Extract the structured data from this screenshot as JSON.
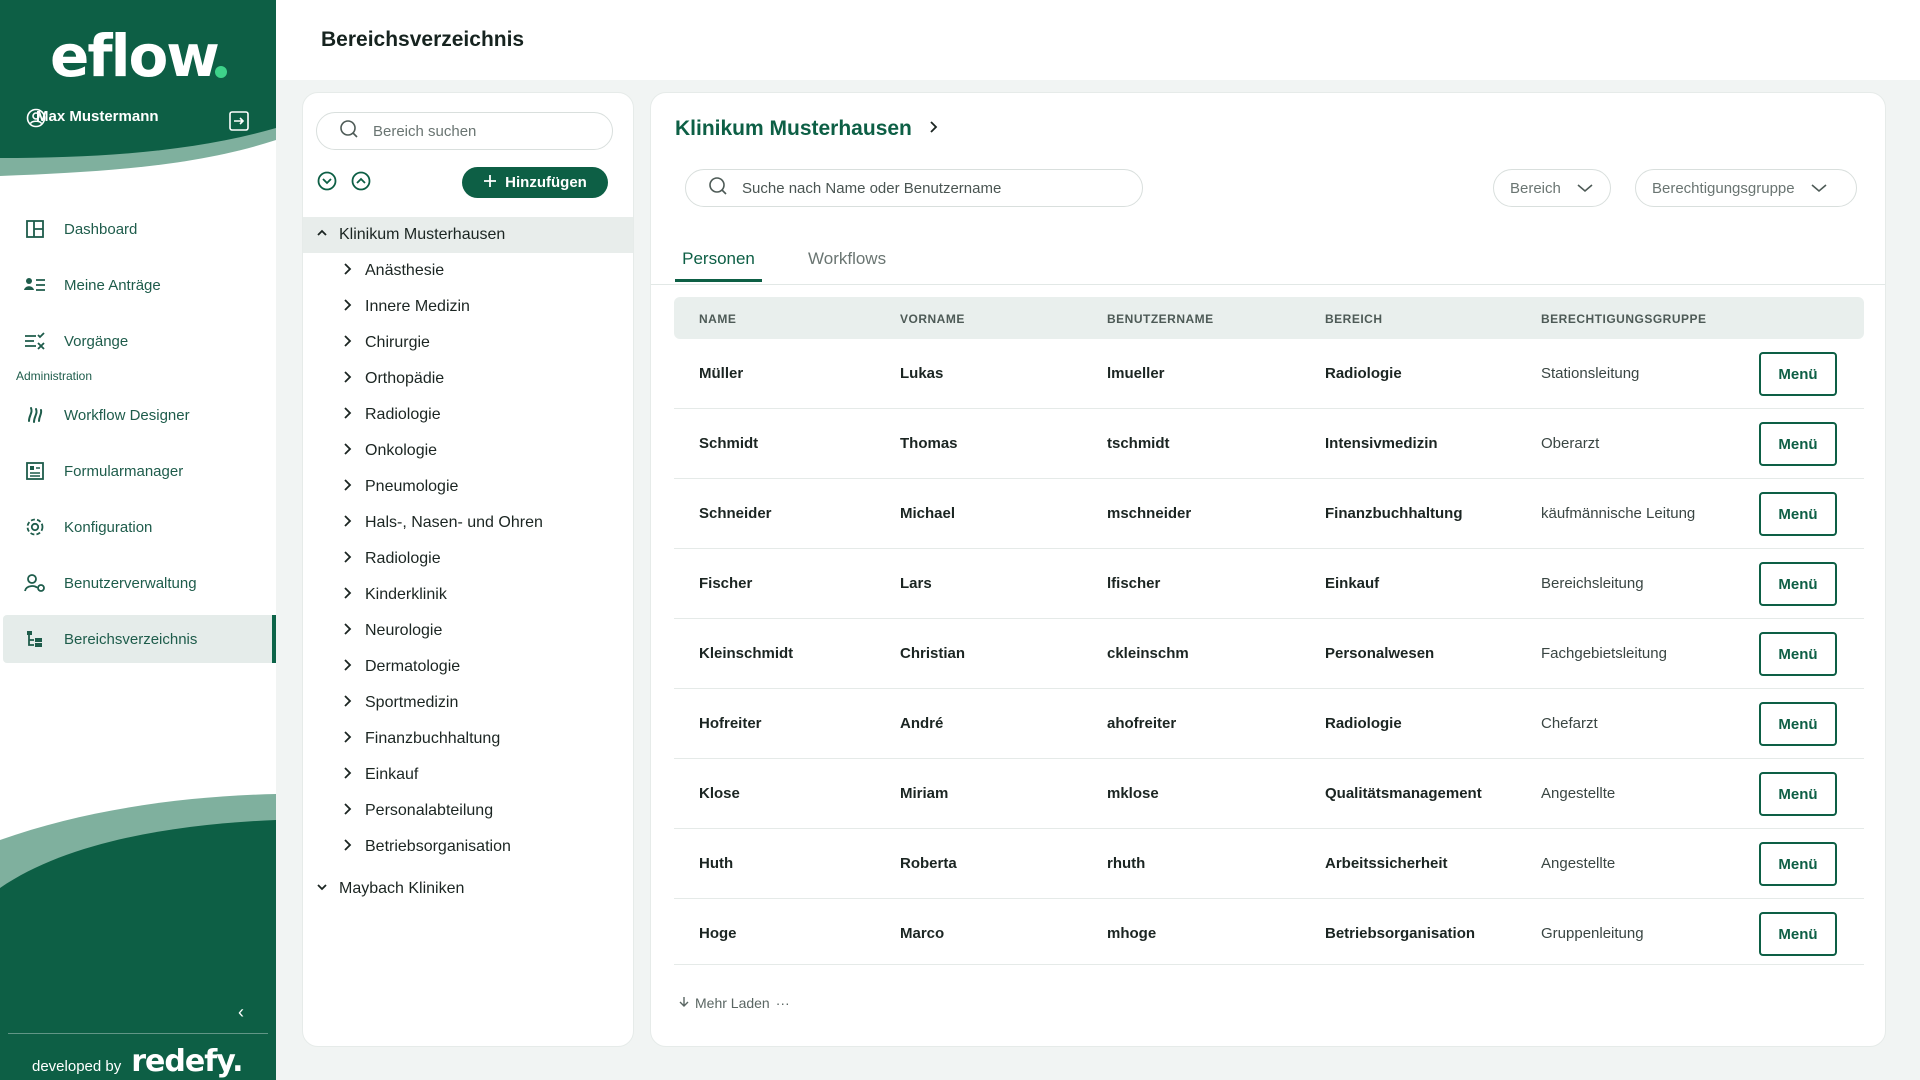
{
  "brand": {
    "logo_text": "eflow",
    "accent": "#0d5f45",
    "accent_light": "#3ed38a"
  },
  "user": {
    "name": "Max Mustermann"
  },
  "nav": {
    "items": [
      {
        "label": "Dashboard",
        "icon": "dashboard-icon"
      },
      {
        "label": "Meine Anträge",
        "icon": "list-user-icon"
      },
      {
        "label": "Vorgänge",
        "icon": "checklist-icon"
      }
    ],
    "section_label": "Administration",
    "admin_items": [
      {
        "label": "Workflow Designer",
        "icon": "workflow-icon"
      },
      {
        "label": "Formularmanager",
        "icon": "form-icon"
      },
      {
        "label": "Konfiguration",
        "icon": "gear-icon"
      },
      {
        "label": "Benutzerverwaltung",
        "icon": "user-settings-icon"
      },
      {
        "label": "Bereichsverzeichnis",
        "icon": "tree-icon",
        "active": true
      }
    ]
  },
  "footer": {
    "developed_by": "developed by",
    "brand": "redefy."
  },
  "page": {
    "title": "Bereichsverzeichnis"
  },
  "tree": {
    "search_placeholder": "Bereich suchen",
    "add_label": "Hinzufügen",
    "root": "Klinikum Musterhausen",
    "children": [
      "Anästhesie",
      "Innere Medizin",
      "Chirurgie",
      "Orthopädie",
      "Radiologie",
      "Onkologie",
      "Pneumologie",
      "Hals-, Nasen- und Ohren",
      "Radiologie",
      "Kinderklinik",
      "Neurologie",
      "Dermatologie",
      "Sportmedizin",
      "Finanzbuchhaltung",
      "Einkauf",
      "Personalabteilung",
      "Betriebsorganisation"
    ],
    "second_root": "Maybach Kliniken"
  },
  "main": {
    "breadcrumb": "Klinikum Musterhausen",
    "search_placeholder": "Suche nach Name oder Benutzername",
    "filters": {
      "bereich": "Bereich",
      "gruppe": "Berechtigungsgruppe"
    },
    "tabs": {
      "personen": "Personen",
      "workflows": "Workflows"
    },
    "columns": [
      "NAME",
      "VORNAME",
      "BENUTZERNAME",
      "BEREICH",
      "BERECHTIGUNGSGRUPPE"
    ],
    "menu_label": "Menü",
    "rows": [
      [
        "Müller",
        "Lukas",
        "lmueller",
        "Radiologie",
        "Stationsleitung"
      ],
      [
        "Schmidt",
        "Thomas",
        "tschmidt",
        "Intensivmedizin",
        "Oberarzt"
      ],
      [
        "Schneider",
        "Michael",
        "mschneider",
        "Finanzbuchhaltung",
        "käufmännische Leitung"
      ],
      [
        "Fischer",
        "Lars",
        "lfischer",
        "Einkauf",
        "Bereichsleitung"
      ],
      [
        "Kleinschmidt",
        "Christian",
        "ckleinschm",
        "Personalwesen",
        "Fachgebietsleitung"
      ],
      [
        "Hofreiter",
        "André",
        "ahofreiter",
        "Radiologie",
        "Chefarzt"
      ],
      [
        "Klose",
        "Miriam",
        "mklose",
        "Qualitätsmanagement",
        "Angestellte"
      ],
      [
        "Huth",
        "Roberta",
        "rhuth",
        "Arbeitssicherheit",
        "Angestellte"
      ],
      [
        "Hoge",
        "Marco",
        "mhoge",
        "Betriebsorganisation",
        "Gruppenleitung"
      ]
    ],
    "load_more": "Mehr Laden"
  }
}
